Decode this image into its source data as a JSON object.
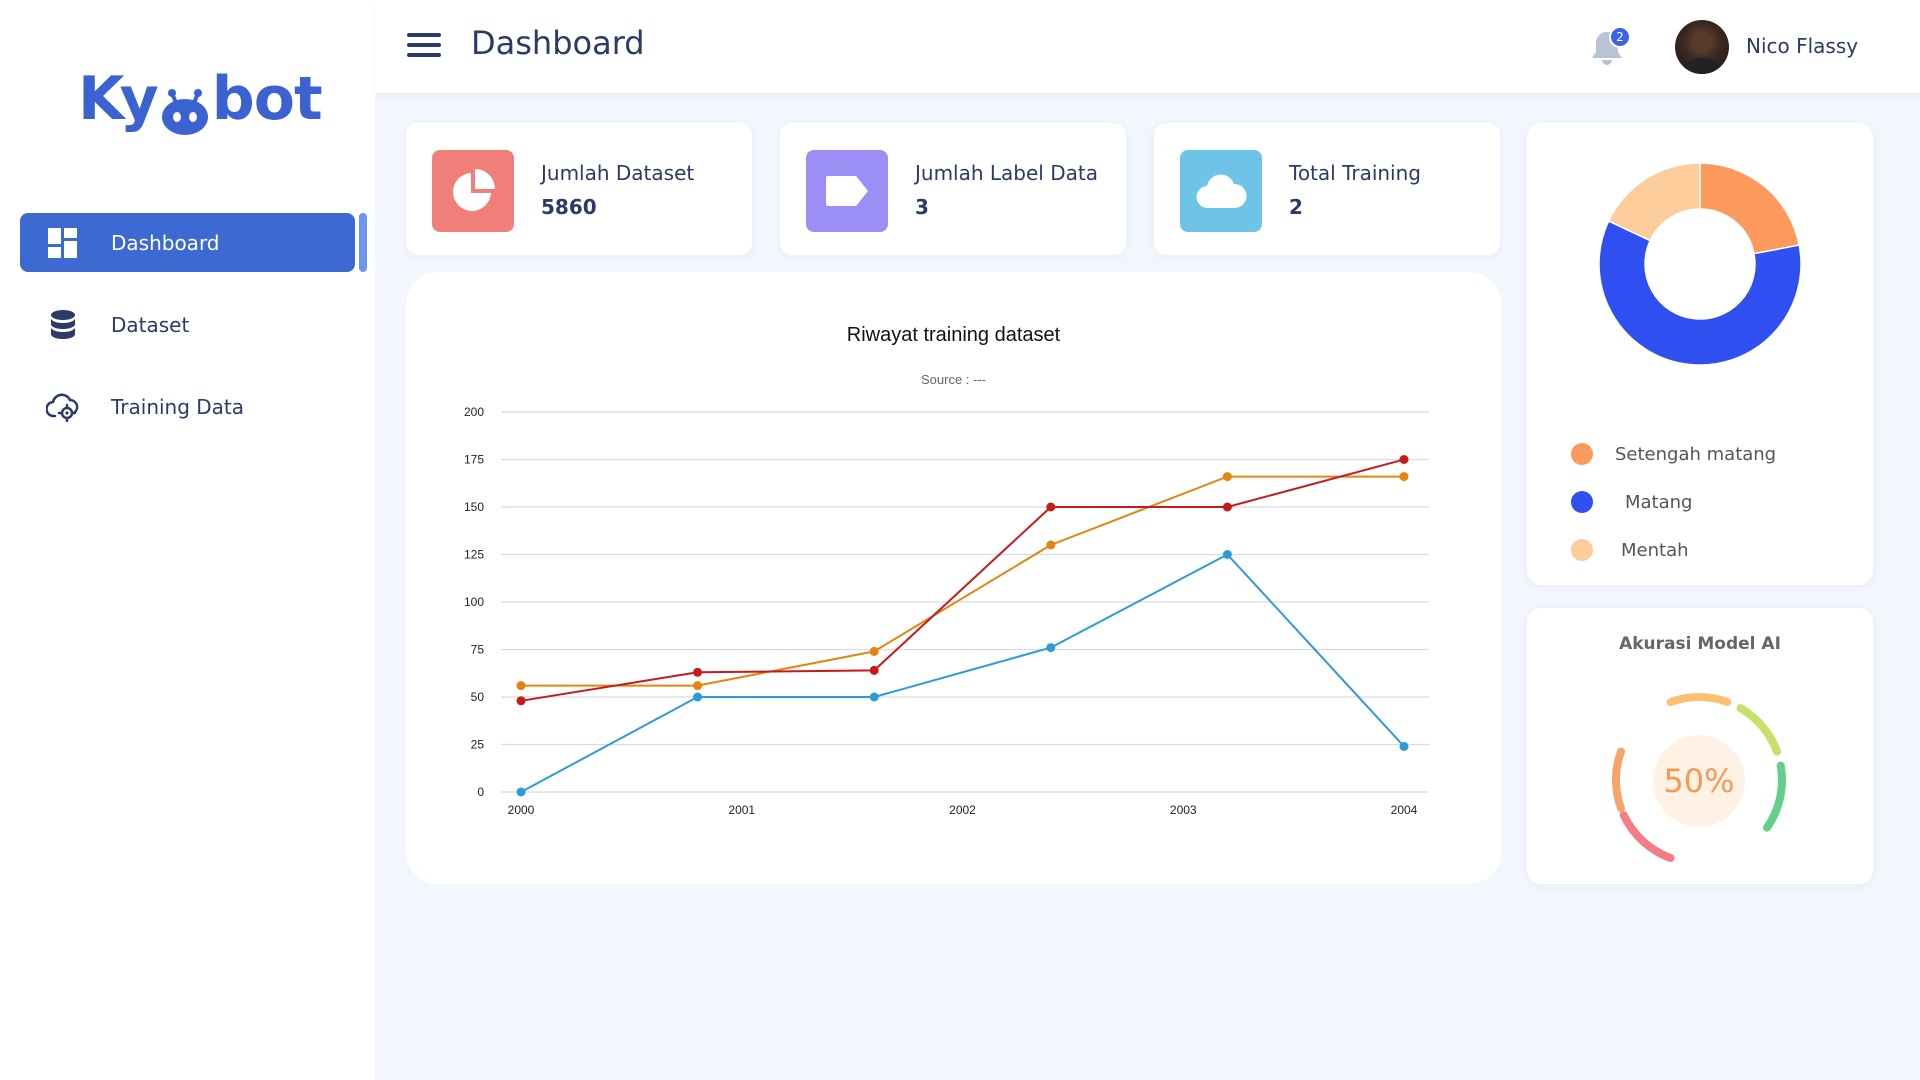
{
  "app": {
    "logo_text_left": "Ky",
    "logo_text_right": "bot"
  },
  "sidebar": {
    "items": [
      {
        "label": "Dashboard",
        "icon": "dashboard-icon",
        "active": true
      },
      {
        "label": "Dataset",
        "icon": "database-icon",
        "active": false
      },
      {
        "label": "Training Data",
        "icon": "cloud-gear-icon",
        "active": false
      }
    ]
  },
  "header": {
    "title": "Dashboard",
    "notification_count": "2",
    "user_name": "Nico Flassy"
  },
  "stats": [
    {
      "title": "Jumlah Dataset",
      "value": "5860",
      "icon": "pie-chart-icon",
      "color": "#f07f79"
    },
    {
      "title": "Jumlah Label Data",
      "value": "3",
      "icon": "label-tag-icon",
      "color": "#9b8ff5"
    },
    {
      "title": "Total Training",
      "value": "2",
      "icon": "cloud-icon",
      "color": "#6ec3e6"
    }
  ],
  "chart_data": {
    "type": "line",
    "title": "Riwayat training dataset",
    "subtitle": "Source : ---",
    "xlabel": "",
    "ylabel": "",
    "x": [
      "2000",
      "2001",
      "2002",
      "2003",
      "2004"
    ],
    "ylim": [
      0,
      200
    ],
    "yticks": [
      0,
      25,
      50,
      75,
      100,
      125,
      150,
      175,
      200
    ],
    "grid": true,
    "series": [
      {
        "color": "#e6830e",
        "points": [
          [
            0,
            56
          ],
          [
            0.8,
            56
          ],
          [
            1.6,
            74
          ],
          [
            2.4,
            130
          ],
          [
            3.2,
            166
          ],
          [
            4,
            166
          ]
        ]
      },
      {
        "color": "#c41b1b",
        "points": [
          [
            0,
            48
          ],
          [
            0.8,
            63
          ],
          [
            1.6,
            64
          ],
          [
            2.4,
            150
          ],
          [
            3.2,
            150
          ],
          [
            4,
            175
          ]
        ]
      },
      {
        "color": "#2e9bd8",
        "points": [
          [
            0,
            0
          ],
          [
            0.8,
            50
          ],
          [
            1.6,
            50
          ],
          [
            2.4,
            76
          ],
          [
            3.2,
            125
          ],
          [
            4,
            24
          ]
        ]
      }
    ]
  },
  "donut": {
    "slices": [
      {
        "label": "Setengah matang",
        "value": 22,
        "color": "#fc9a5e"
      },
      {
        "label": "Matang",
        "value": 60,
        "color": "#2f4ff0"
      },
      {
        "label": "Mentah",
        "value": 18,
        "color": "#fdcc9b"
      }
    ]
  },
  "accuracy": {
    "title": "Akurasi Model AI",
    "value_label": "50%",
    "value": 0.5
  }
}
